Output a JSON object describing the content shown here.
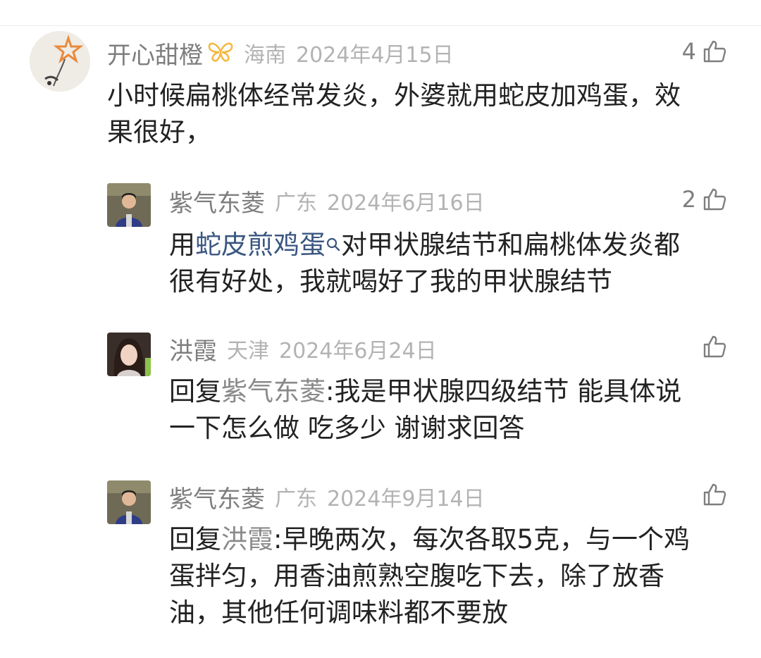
{
  "comments": [
    {
      "name": "开心甜橙",
      "badge_icon": "butterfly-badge-icon",
      "location": "海南",
      "date": "2024年4月15日",
      "likes": "4",
      "text_line1": "小时候扁桃体经常发炎，外婆就用蛇皮加鸡蛋，效",
      "text_line2": "果很好，"
    },
    {
      "name": "紫气东菱",
      "location": "广东",
      "date": "2024年6月16日",
      "likes": "2",
      "text_prefix": "用",
      "link_text": "蛇皮煎鸡蛋",
      "link_icon": "search-icon",
      "text_after_link": "对甲状腺结节和扁桃体发炎都",
      "text_line2": "很有好处，我就喝好了我的甲状腺结节"
    },
    {
      "name": "洪霞",
      "location": "天津",
      "date": "2024年6月24日",
      "likes": "",
      "reply_prefix": "回复",
      "reply_to": "紫气东菱",
      "text_after_reply": ":我是甲状腺四级结节 能具体说",
      "text_line2": "一下怎么做 吃多少 谢谢求回答"
    },
    {
      "name": "紫气东菱",
      "location": "广东",
      "date": "2024年9月14日",
      "likes": "",
      "reply_prefix": "回复",
      "reply_to": "洪霞",
      "text_after_reply": ":早晚两次，每次各取5克，与一个鸡",
      "text_line2": "蛋拌匀，用香油煎熟空腹吃下去，除了放香",
      "text_line3": "油，其他任何调味料都不要放"
    }
  ],
  "colors": {
    "name": "#7e7e7e",
    "meta": "#b3b3b3",
    "text": "#222222",
    "link": "#3a5680",
    "badge": "#f5b73c"
  }
}
